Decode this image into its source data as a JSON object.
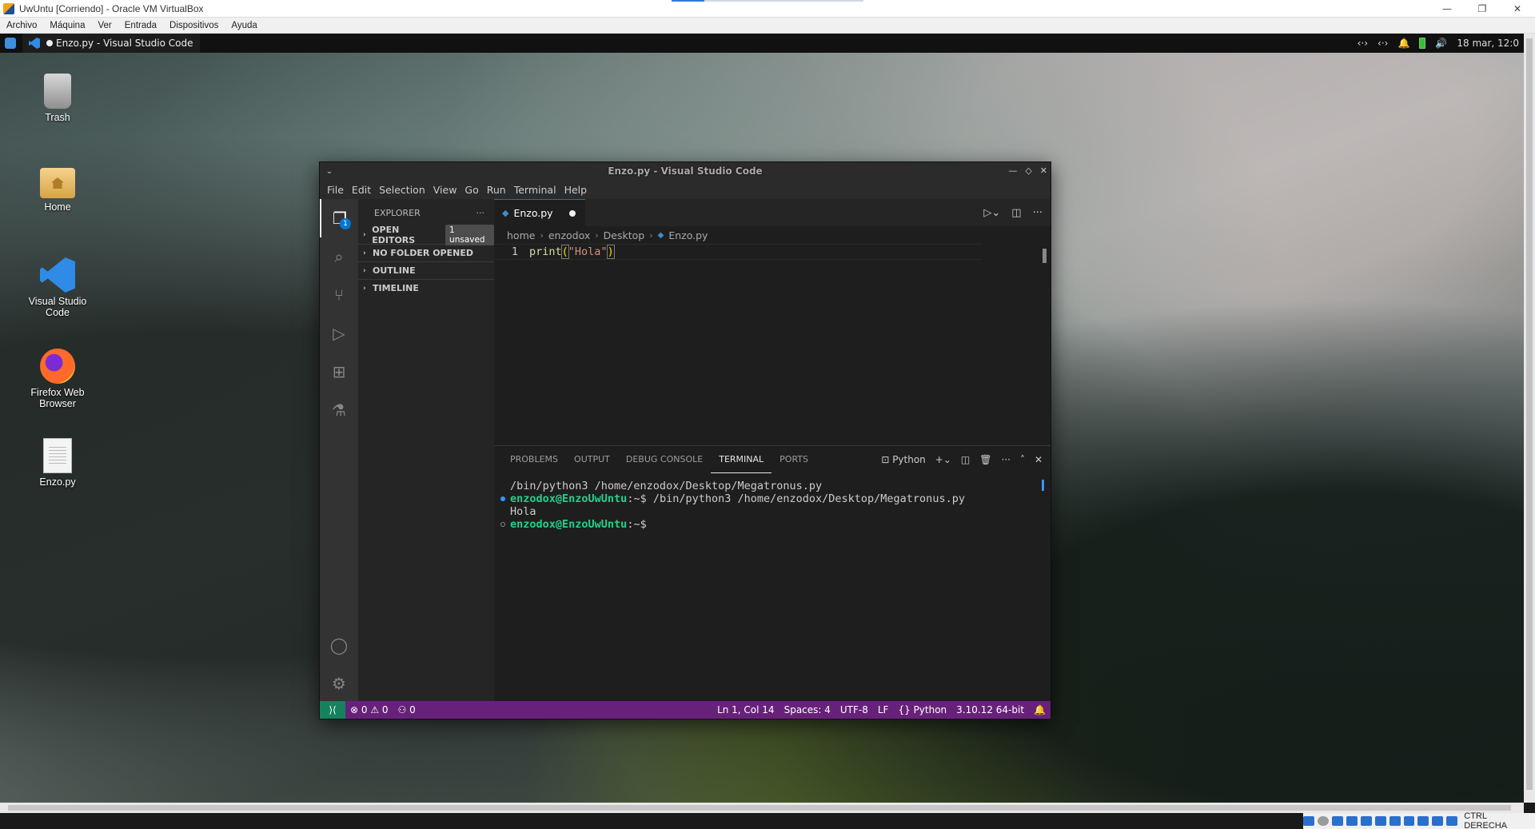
{
  "host": {
    "title": "UwUntu [Corriendo] - Oracle VM VirtualBox",
    "window_controls": [
      "—",
      "❐",
      "✕"
    ],
    "menu": [
      "Archivo",
      "Máquina",
      "Ver",
      "Entrada",
      "Dispositivos",
      "Ayuda"
    ],
    "tray_text": "CTRL DERECHA"
  },
  "panel": {
    "task_title": "Enzo.py - Visual Studio Code",
    "date": "18 mar, 12:0"
  },
  "desktop": {
    "icons": [
      {
        "label": "Trash"
      },
      {
        "label": "Home"
      },
      {
        "label": "Visual Studio Code"
      },
      {
        "label": "Firefox Web Browser"
      },
      {
        "label": "Enzo.py"
      }
    ]
  },
  "vscode": {
    "title": "Enzo.py - Visual Studio Code",
    "menu": [
      "File",
      "Edit",
      "Selection",
      "View",
      "Go",
      "Run",
      "Terminal",
      "Help"
    ],
    "explorer_badge": "1",
    "sidebar": {
      "header": "EXPLORER",
      "sections": [
        {
          "label": "OPEN EDITORS",
          "badge": "1 unsaved"
        },
        {
          "label": "NO FOLDER OPENED"
        },
        {
          "label": "OUTLINE"
        },
        {
          "label": "TIMELINE"
        }
      ]
    },
    "tab": {
      "label": "Enzo.py"
    },
    "breadcrumb": [
      "home",
      "enzodox",
      "Desktop",
      "Enzo.py"
    ],
    "code": {
      "line_number": "1",
      "fn": "print",
      "open": "(",
      "str": "\"Hola\"",
      "close": ")"
    },
    "panel_tabs": [
      "PROBLEMS",
      "OUTPUT",
      "DEBUG CONSOLE",
      "TERMINAL",
      "PORTS"
    ],
    "terminal_profile": "Python",
    "terminal": {
      "line1": "/bin/python3 /home/enzodox/Desktop/Megatronus.py",
      "prompt_user": "enzodox@EnzoUwUntu",
      "prompt_rest": ":~$ /bin/python3 /home/enzodox/Desktop/Megatronus.py",
      "output": "Hola",
      "prompt2_rest": ":~$"
    },
    "status": {
      "errors": "0",
      "warnings": "0",
      "ports": "0",
      "position": "Ln 1, Col 14",
      "spaces": "Spaces: 4",
      "encoding": "UTF-8",
      "eol": "LF",
      "language": "Python",
      "interpreter": "3.10.12 64-bit"
    }
  }
}
